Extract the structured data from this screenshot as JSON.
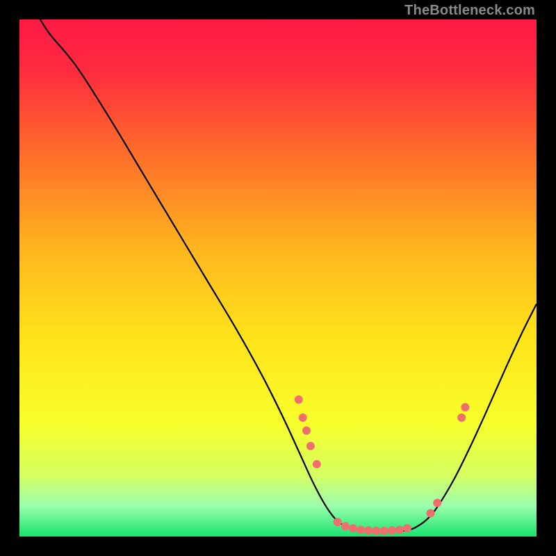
{
  "watermark": "TheBottleneck.com",
  "chart_data": {
    "type": "line",
    "title": "",
    "xlabel": "",
    "ylabel": "",
    "xlim": [
      0,
      100
    ],
    "ylim": [
      0,
      100
    ],
    "background_gradient": {
      "stops": [
        {
          "pos": 0.0,
          "color": "#ff1a44"
        },
        {
          "pos": 0.1,
          "color": "#ff2b3f"
        },
        {
          "pos": 0.25,
          "color": "#ff6a2b"
        },
        {
          "pos": 0.45,
          "color": "#ffb81e"
        },
        {
          "pos": 0.62,
          "color": "#ffe41a"
        },
        {
          "pos": 0.78,
          "color": "#f8ff2a"
        },
        {
          "pos": 0.88,
          "color": "#d6ff60"
        },
        {
          "pos": 0.94,
          "color": "#9cffad"
        },
        {
          "pos": 1.0,
          "color": "#17e36f"
        }
      ]
    },
    "series": [
      {
        "name": "bottleneck-curve",
        "stroke": "#000000",
        "points": [
          {
            "x": 4.0,
            "y": 100.0
          },
          {
            "x": 6.0,
            "y": 97.0
          },
          {
            "x": 9.0,
            "y": 93.5
          },
          {
            "x": 12.0,
            "y": 89.5
          },
          {
            "x": 18.0,
            "y": 80.0
          },
          {
            "x": 24.0,
            "y": 70.0
          },
          {
            "x": 30.0,
            "y": 60.0
          },
          {
            "x": 36.0,
            "y": 50.0
          },
          {
            "x": 42.0,
            "y": 40.0
          },
          {
            "x": 47.0,
            "y": 31.0
          },
          {
            "x": 51.0,
            "y": 23.0
          },
          {
            "x": 54.0,
            "y": 16.5
          },
          {
            "x": 57.0,
            "y": 10.0
          },
          {
            "x": 59.5,
            "y": 5.5
          },
          {
            "x": 61.5,
            "y": 3.0
          },
          {
            "x": 63.5,
            "y": 1.8
          },
          {
            "x": 66.0,
            "y": 1.2
          },
          {
            "x": 69.0,
            "y": 1.0
          },
          {
            "x": 72.0,
            "y": 1.0
          },
          {
            "x": 75.0,
            "y": 1.2
          },
          {
            "x": 77.0,
            "y": 2.0
          },
          {
            "x": 79.0,
            "y": 3.5
          },
          {
            "x": 81.0,
            "y": 6.0
          },
          {
            "x": 84.0,
            "y": 11.0
          },
          {
            "x": 87.0,
            "y": 17.0
          },
          {
            "x": 90.0,
            "y": 23.5
          },
          {
            "x": 94.0,
            "y": 32.5
          },
          {
            "x": 97.0,
            "y": 39.0
          },
          {
            "x": 100.0,
            "y": 45.0
          }
        ]
      }
    ],
    "markers": {
      "color": "#ef6f6f",
      "radius": 6,
      "points": [
        {
          "x": 54.0,
          "y": 26.5
        },
        {
          "x": 54.8,
          "y": 23.0
        },
        {
          "x": 55.5,
          "y": 20.5
        },
        {
          "x": 56.3,
          "y": 17.5
        },
        {
          "x": 57.5,
          "y": 14.0
        },
        {
          "x": 61.5,
          "y": 2.8
        },
        {
          "x": 63.0,
          "y": 2.0
        },
        {
          "x": 64.5,
          "y": 1.6
        },
        {
          "x": 66.0,
          "y": 1.3
        },
        {
          "x": 67.5,
          "y": 1.2
        },
        {
          "x": 69.0,
          "y": 1.1
        },
        {
          "x": 70.5,
          "y": 1.1
        },
        {
          "x": 72.0,
          "y": 1.2
        },
        {
          "x": 73.5,
          "y": 1.3
        },
        {
          "x": 75.0,
          "y": 1.6
        },
        {
          "x": 79.5,
          "y": 4.5
        },
        {
          "x": 80.8,
          "y": 6.5
        },
        {
          "x": 85.5,
          "y": 23.0
        },
        {
          "x": 86.2,
          "y": 25.0
        }
      ]
    }
  }
}
